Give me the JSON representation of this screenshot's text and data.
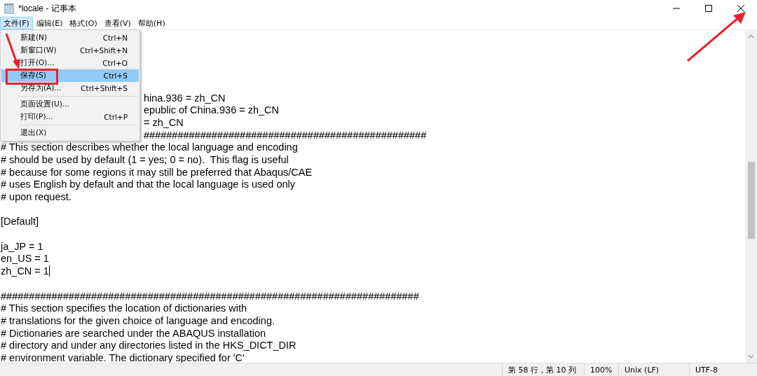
{
  "window": {
    "title": "*locale - 记事本"
  },
  "menubar": [
    {
      "label": "文件(F)",
      "selected": true
    },
    {
      "label": "编辑(E)",
      "selected": false
    },
    {
      "label": "格式(O)",
      "selected": false
    },
    {
      "label": "查看(V)",
      "selected": false
    },
    {
      "label": "帮助(H)",
      "selected": false
    }
  ],
  "file_menu": [
    {
      "kind": "item",
      "label": "新建(N)",
      "shortcut": "Ctrl+N",
      "selected": false
    },
    {
      "kind": "item",
      "label": "新窗口(W)",
      "shortcut": "Ctrl+Shift+N",
      "selected": false
    },
    {
      "kind": "item",
      "label": "打开(O)...",
      "shortcut": "Ctrl+O",
      "selected": false
    },
    {
      "kind": "item",
      "label": "保存(S)",
      "shortcut": "Ctrl+S",
      "selected": true
    },
    {
      "kind": "item",
      "label": "另存为(A)...",
      "shortcut": "Ctrl+Shift+S",
      "selected": false
    },
    {
      "kind": "separator"
    },
    {
      "kind": "item",
      "label": "页面设置(U)...",
      "selected": false
    },
    {
      "kind": "item",
      "label": "打印(P)...",
      "shortcut": "Ctrl+P",
      "selected": false
    },
    {
      "kind": "separator"
    },
    {
      "kind": "item",
      "label": "退出(X)",
      "selected": false
    }
  ],
  "editor_lines": [
    {
      "kind": "partial",
      "text": "hina.936 = zh_CN"
    },
    {
      "kind": "partial",
      "text": "epublic of China.936 = zh_CN"
    },
    {
      "kind": "partial",
      "text": "= zh_CN"
    },
    {
      "kind": "partial",
      "text": "##################################################"
    },
    {
      "kind": "text",
      "text": "# This section describes whether the local language and encoding"
    },
    {
      "kind": "text",
      "text": "# should be used by default (1 = yes; 0 = no).  This flag is useful"
    },
    {
      "kind": "text",
      "text": "# because for some regions it may still be preferred that Abaqus/CAE"
    },
    {
      "kind": "text",
      "text": "# uses English by default and that the local language is used only"
    },
    {
      "kind": "text",
      "text": "# upon request."
    },
    {
      "kind": "blank"
    },
    {
      "kind": "text",
      "text": "[Default]"
    },
    {
      "kind": "blank"
    },
    {
      "kind": "text",
      "text": "ja_JP = 1"
    },
    {
      "kind": "text",
      "text": "en_US = 1"
    },
    {
      "kind": "caret",
      "text": "zh_CN = 1"
    },
    {
      "kind": "blank"
    },
    {
      "kind": "text",
      "text": "##########################################################################"
    },
    {
      "kind": "text",
      "text": "# This section specifies the location of dictionaries with"
    },
    {
      "kind": "text",
      "text": "# translations for the given choice of language and encoding."
    },
    {
      "kind": "text",
      "text": "# Dictionaries are searched under the ABAQUS installation"
    },
    {
      "kind": "text",
      "text": "# directory and under any directories listed in the HKS_DICT_DIR"
    },
    {
      "kind": "text",
      "text": "# environment variable. The dictionary specified for 'C'"
    }
  ],
  "status_bar": [
    "第 58 行，第 10 列",
    "100%",
    "Unix (LF)",
    "UTF-8"
  ]
}
